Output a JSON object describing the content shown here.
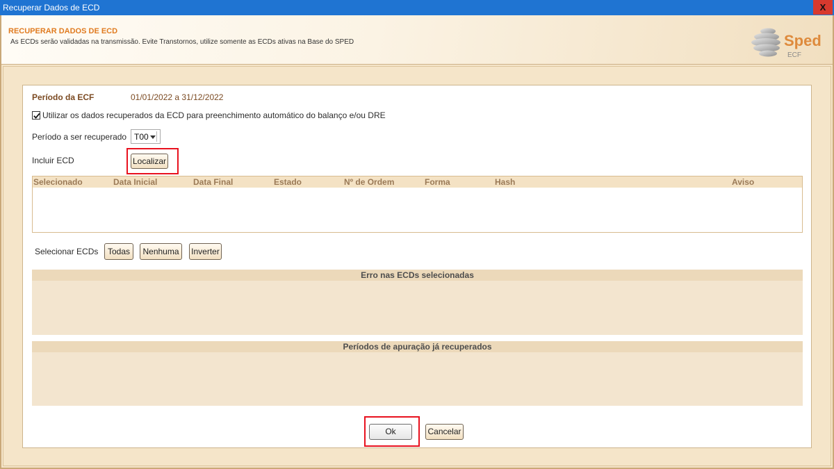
{
  "window": {
    "title": "Recuperar Dados de ECD",
    "close_label": "X"
  },
  "header": {
    "title": "RECUPERAR DADOS DE ECD",
    "subtitle": "As ECDs serão validadas na transmissão. Evite Transtornos, utilize somente as ECDs ativas na Base do SPED",
    "logo_text": "Sped",
    "logo_sub": "ECF"
  },
  "form": {
    "periodo_ecf_label": "Período da ECF",
    "periodo_ecf_value": "01/01/2022 a 31/12/2022",
    "checkbox_label": "Utilizar os dados recuperados da ECD para preenchimento automático do balanço e/ou DRE",
    "checkbox_checked": true,
    "periodo_recuperado_label": "Período a ser recuperado",
    "periodo_recuperado_value": "T00",
    "incluir_ecd_label": "Incluir ECD",
    "localizar_label": "Localizar"
  },
  "table": {
    "columns": [
      "Selecionado",
      "Data Inicial",
      "Data Final",
      "Estado",
      "Nº de Ordem",
      "Forma",
      "Hash",
      "Aviso"
    ],
    "rows": []
  },
  "selection": {
    "label": "Selecionar ECDs",
    "todas": "Todas",
    "nenhuma": "Nenhuma",
    "inverter": "Inverter"
  },
  "errors_panel": {
    "title": "Erro nas ECDs selecionadas"
  },
  "periods_panel": {
    "title": "Períodos de apuração já recuperados"
  },
  "footer": {
    "ok_label": "Ok",
    "cancel_label": "Cancelar"
  },
  "colors": {
    "title_bar": "#1f74d2",
    "accent": "#e07b20",
    "label": "#7b4a22",
    "highlight": "#e8111e",
    "logo": "#de8a3c"
  }
}
